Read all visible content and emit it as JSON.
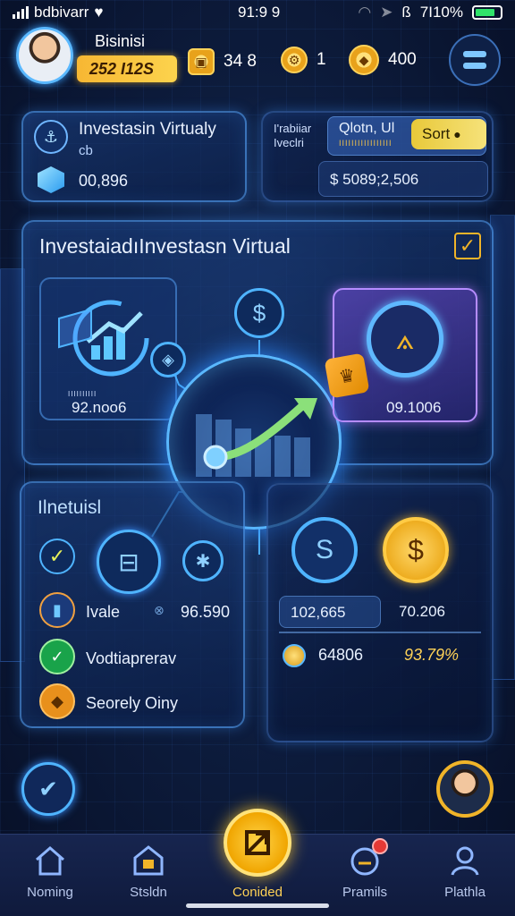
{
  "status_bar": {
    "carrier": "bdbivarr",
    "time": "91:9 9",
    "battery": "7I10%"
  },
  "header": {
    "user_name": "Bisinisi",
    "coin_value": "252 I12S",
    "stat_1": "34 8",
    "stat_2": "1",
    "stat_3": "400"
  },
  "card_left": {
    "title": "Investasin Virtualy",
    "subtitle": "cb",
    "value": "00,896"
  },
  "card_right": {
    "label_line1": "I'rabiiar",
    "label_line2": "Iveclri",
    "header_text": "Qlotn, Ul",
    "header_sub": "IIIIIIIIIIIIIIIII",
    "sort_label": "Sort",
    "value": "$ 5089;2,506"
  },
  "main_panel": {
    "title": "InvestaiadıInvestasn Virtual",
    "left_value": "92.noo6",
    "left_sub": "IIIIIIIIII",
    "right_value": "09.1006"
  },
  "lower_left": {
    "title": "Ilnetuisl",
    "rows": [
      {
        "label": "Ivale",
        "value": "96.590"
      },
      {
        "label": "Vodtiaprerav"
      },
      {
        "label": "Seorely Oiny"
      }
    ]
  },
  "lower_right": {
    "value_1": "102,665",
    "value_2": "70.206",
    "value_3": "64806",
    "value_4": "93.79%"
  },
  "bottom_nav": {
    "items": [
      {
        "label": "Noming"
      },
      {
        "label": "Stsldn"
      },
      {
        "label": "Conided"
      },
      {
        "label": "Pramils"
      },
      {
        "label": "Plathla"
      }
    ]
  },
  "colors": {
    "accent_blue": "#5ab8ff",
    "gold": "#f0b429",
    "background": "#0d1c3d"
  }
}
